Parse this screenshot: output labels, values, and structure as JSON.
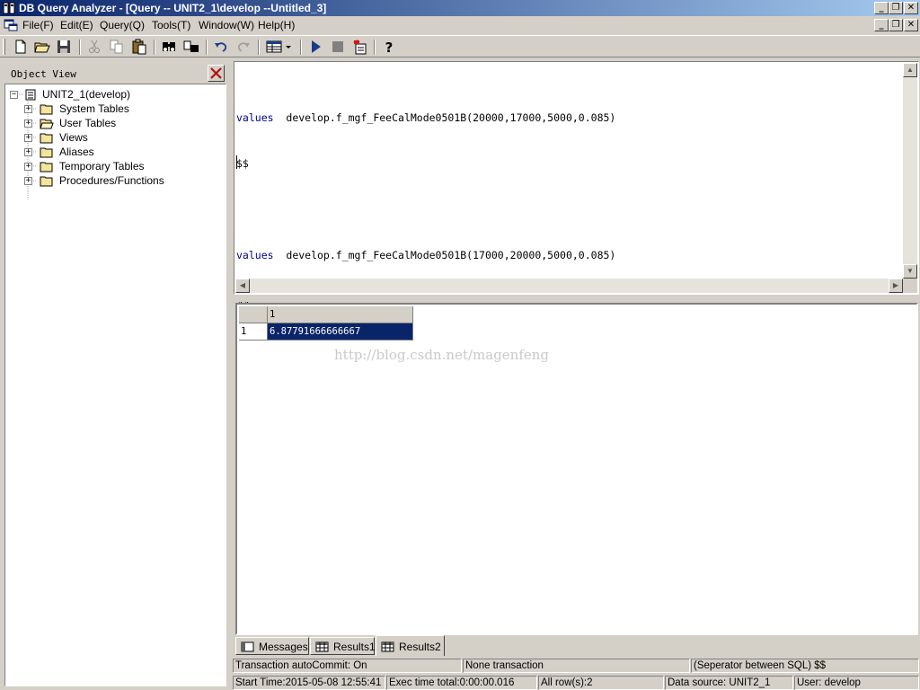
{
  "window": {
    "title": "DB Query Analyzer - [Query -- UNIT2_1\\develop  --Untitled_3]",
    "minimize_glyph": "_",
    "restore_glyph": "❐",
    "close_glyph": "✕"
  },
  "menu": {
    "items": [
      {
        "label": "File(F)"
      },
      {
        "label": "Edit(E)"
      },
      {
        "label": "Query(Q)"
      },
      {
        "label": "Tools(T)"
      },
      {
        "label": "Window(W)"
      },
      {
        "label": "Help(H)"
      }
    ]
  },
  "toolbar": {
    "icons": [
      "new-file-icon",
      "open-folder-icon",
      "save-icon",
      "cut-icon",
      "copy-icon",
      "paste-icon",
      "find-icon",
      "replace-icon",
      "undo-icon",
      "redo-icon",
      "grid-view-icon",
      "execute-icon",
      "stop-icon",
      "export-icon",
      "help-icon"
    ]
  },
  "object_view": {
    "title": "Object View",
    "root": "UNIT2_1(develop)",
    "items": [
      {
        "label": "System Tables"
      },
      {
        "label": "User Tables"
      },
      {
        "label": "Views"
      },
      {
        "label": "Aliases"
      },
      {
        "label": "Temporary Tables"
      },
      {
        "label": "Procedures/Functions"
      }
    ]
  },
  "editor": {
    "lines": [
      {
        "keyword": "values",
        "text": "  develop.f_mgf_FeeCalMode0501B(20000,17000,5000,0.085)"
      },
      {
        "keyword": "",
        "text": "$$"
      },
      {
        "keyword": "",
        "text": ""
      },
      {
        "keyword": "values",
        "text": "  develop.f_mgf_FeeCalMode0501B(17000,20000,5000,0.085)"
      },
      {
        "keyword": "",
        "text": "$$"
      }
    ]
  },
  "results": {
    "columns": [
      "1"
    ],
    "rows": [
      {
        "index": "1",
        "values": [
          "6.87791666666667"
        ]
      }
    ],
    "watermark": "http://blog.csdn.net/magenfeng"
  },
  "tabs": [
    {
      "label": "Messages",
      "active": false
    },
    {
      "label": "Results1",
      "active": false
    },
    {
      "label": "Results2",
      "active": true
    }
  ],
  "status": {
    "autocommit": "Transaction autoCommit: On",
    "transaction": "None transaction",
    "separator": "(Seperator between SQL)   $$",
    "start_time": "Start Time:2015-05-08 12:55:41",
    "exec_time": "Exec time total:0:00:00.016",
    "rows": "All row(s):2",
    "data_source": "Data source: UNIT2_1",
    "user": "User: develop"
  },
  "colors": {
    "title_gradient_start": "#0a246a",
    "title_gradient_end": "#a6caf0",
    "keyword": "#00008b",
    "selection": "#0a246a",
    "chrome": "#d4d0c8"
  }
}
